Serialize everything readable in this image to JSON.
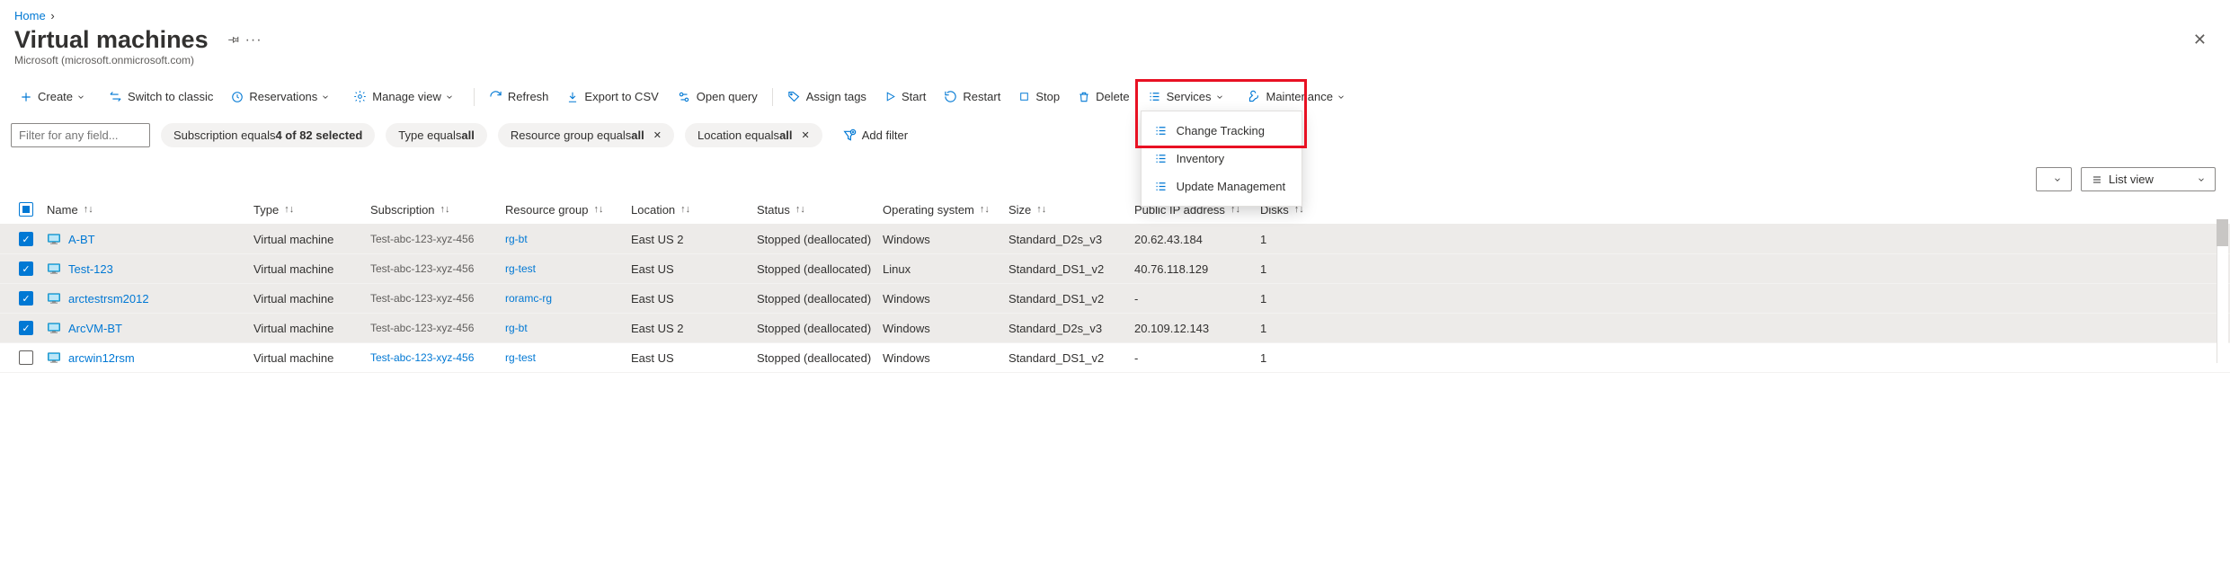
{
  "breadcrumb": {
    "home": "Home"
  },
  "header": {
    "title": "Virtual machines",
    "subtitle": "Microsoft (microsoft.onmicrosoft.com)"
  },
  "toolbar": {
    "create": "Create",
    "switch": "Switch to classic",
    "reservations": "Reservations",
    "manage_view": "Manage view",
    "refresh": "Refresh",
    "export_csv": "Export to CSV",
    "open_query": "Open query",
    "assign_tags": "Assign tags",
    "start": "Start",
    "restart": "Restart",
    "stop": "Stop",
    "delete": "Delete",
    "services": "Services",
    "maintenance": "Maintenance"
  },
  "services_menu": {
    "change_tracking": "Change Tracking",
    "inventory": "Inventory",
    "update_mgmt": "Update Management"
  },
  "filters": {
    "placeholder": "Filter for any field...",
    "sub_prefix": "Subscription equals ",
    "sub_bold": "4 of 82 selected",
    "type_prefix": "Type equals ",
    "type_bold": "all",
    "rg_prefix": "Resource group equals ",
    "rg_bold": "all",
    "loc_prefix": "Location equals ",
    "loc_bold": "all",
    "add_filter": "Add filter"
  },
  "view": {
    "list_view": "List view"
  },
  "columns": {
    "name": "Name",
    "type": "Type",
    "sub": "Subscription",
    "rg": "Resource group",
    "location": "Location",
    "status": "Status",
    "os": "Operating system",
    "size": "Size",
    "ip": "Public IP address",
    "disks": "Disks"
  },
  "rows": [
    {
      "selected": true,
      "name": "A-BT",
      "type": "Virtual machine",
      "sub": "Test-abc-123-xyz-456",
      "sub_blue": false,
      "rg": "rg-bt",
      "loc": "East US 2",
      "status": "Stopped (deallocated)",
      "os": "Windows",
      "size": "Standard_D2s_v3",
      "ip": "20.62.43.184",
      "disks": "1"
    },
    {
      "selected": true,
      "name": "Test-123",
      "type": "Virtual machine",
      "sub": "Test-abc-123-xyz-456",
      "sub_blue": false,
      "rg": "rg-test",
      "loc": "East US",
      "status": "Stopped (deallocated)",
      "os": "Linux",
      "size": "Standard_DS1_v2",
      "ip": "40.76.118.129",
      "disks": "1"
    },
    {
      "selected": true,
      "name": "arctestrsm2012",
      "type": "Virtual machine",
      "sub": "Test-abc-123-xyz-456",
      "sub_blue": false,
      "rg": "roramc-rg",
      "loc": "East US",
      "status": "Stopped (deallocated)",
      "os": "Windows",
      "size": "Standard_DS1_v2",
      "ip": "-",
      "disks": "1"
    },
    {
      "selected": true,
      "name": "ArcVM-BT",
      "type": "Virtual machine",
      "sub": "Test-abc-123-xyz-456",
      "sub_blue": false,
      "rg": "rg-bt",
      "loc": "East US 2",
      "status": "Stopped (deallocated)",
      "os": "Windows",
      "size": "Standard_D2s_v3",
      "ip": "20.109.12.143",
      "disks": "1"
    },
    {
      "selected": false,
      "name": "arcwin12rsm",
      "type": "Virtual machine",
      "sub": "Test-abc-123-xyz-456",
      "sub_blue": true,
      "rg": "rg-test",
      "loc": "East US",
      "status": "Stopped (deallocated)",
      "os": "Windows",
      "size": "Standard_DS1_v2",
      "ip": "-",
      "disks": "1"
    }
  ]
}
